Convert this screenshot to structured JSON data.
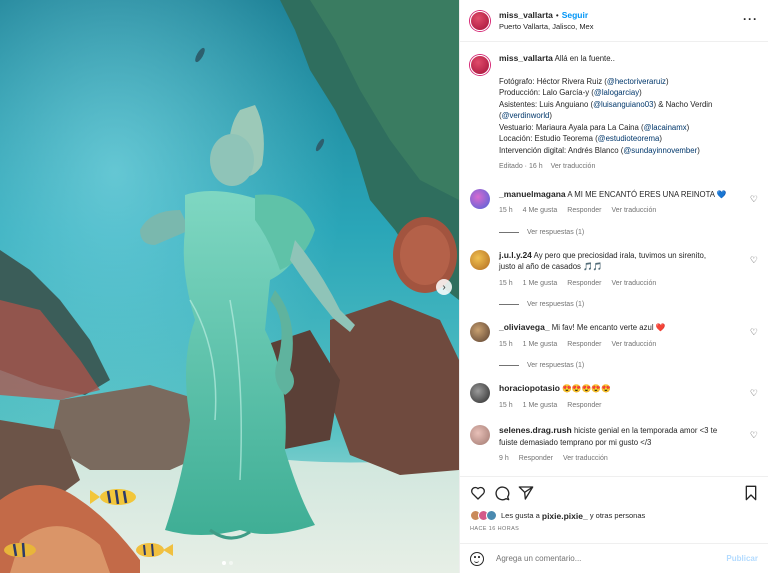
{
  "post": {
    "author": {
      "username": "miss_vallarta",
      "follow_label": "Seguir",
      "location": "Puerto Vallarta, Jalisco, Mex"
    },
    "more_icon": "more-horizontal-icon",
    "caption": {
      "username": "miss_vallarta",
      "first_line": "Allá en la fuente..",
      "credits": [
        {
          "text": "Fotógrafo: Héctor Rivera Ruiz (",
          "mention": "@hectoriveraruiz",
          "tail": ")"
        },
        {
          "text": "Producción: Lalo García-y (",
          "mention": "@lalogarciay",
          "tail": ")"
        },
        {
          "text": "Asistentes: Luis Anguiano (",
          "mention": "@luisanguiano03",
          "tail": ") & Nacho Verdin"
        },
        {
          "text": "(",
          "mention": "@verdinworld",
          "tail": ")"
        },
        {
          "text": "Vestuario: Mariaura Ayala para La Caina (",
          "mention": "@lacainamx",
          "tail": ")"
        },
        {
          "text": "Locación: Estudio Teorema (",
          "mention": "@estudioteorema",
          "tail": ")"
        },
        {
          "text": "Intervención digital: Andrés Blanco (",
          "mention": "@sundayinnovember",
          "tail": ")"
        }
      ],
      "edited": "Editado · 16 h",
      "translate": "Ver traducción"
    },
    "comments": [
      {
        "username": "_manuelmagana",
        "text": "A MI ME ENCANTÓ ERES UNA REINOTA 💙",
        "time": "15 h",
        "likes": "4 Me gusta",
        "reply": "Responder",
        "translate": "Ver traducción",
        "replies": "Ver respuestas (1)",
        "avatar_color": "#7a5bd0"
      },
      {
        "username": "j.u.l.y.24",
        "text": "Ay pero que preciosidad irala, tuvimos un sirenito,",
        "text2": "justo al año de casados 🎵🎵",
        "time": "15 h",
        "likes": "1 Me gusta",
        "reply": "Responder",
        "translate": "Ver traducción",
        "replies": "Ver respuestas (1)",
        "avatar_color": "#d89a3a"
      },
      {
        "username": "_oliviavega_",
        "text": "Mi fav! Me encanto verte azul ❤️",
        "time": "15 h",
        "likes": "1 Me gusta",
        "reply": "Responder",
        "translate": "Ver traducción",
        "replies": "Ver respuestas (1)",
        "avatar_color": "#8a6a4a"
      },
      {
        "username": "horaciopotasio",
        "text": "😍😍😍😍😍",
        "time": "15 h",
        "likes": "1 Me gusta",
        "reply": "Responder",
        "avatar_color": "#4a4a4a"
      },
      {
        "username": "selenes.drag.rush",
        "text": "hiciste genial en la temporada amor <3 te",
        "text2": "fuiste demasiado temprano por mi gusto </3",
        "time": "9 h",
        "reply": "Responder",
        "translate": "Ver traducción",
        "avatar_color": "#c9a19a"
      }
    ],
    "likes_text_prefix": "Les gusta a",
    "likes_user": "pixie.pixie_",
    "likes_text_suffix": "y otras personas",
    "time_ago": "HACE 16 HORAS",
    "composer": {
      "placeholder": "Agrega un comentario...",
      "publish": "Publicar"
    },
    "icons": {
      "like": "heart-icon",
      "comment": "comment-icon",
      "share": "send-icon",
      "save": "bookmark-icon",
      "emoji": "emoji-icon",
      "next": "chevron-right-icon"
    },
    "colors": {
      "link_blue": "#0095f6",
      "mention": "#00376b",
      "muted": "#737373"
    }
  }
}
